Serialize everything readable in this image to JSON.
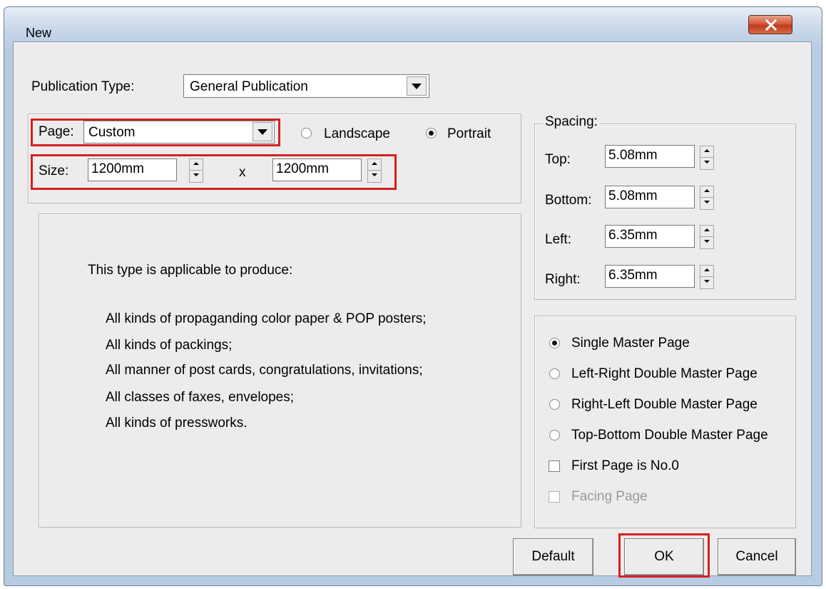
{
  "window": {
    "title": "New"
  },
  "publication": {
    "label": "Publication Type:",
    "value": "General Publication"
  },
  "page": {
    "label": "Page:",
    "value": "Custom"
  },
  "orientation": {
    "landscape_label": "Landscape",
    "portrait_label": "Portrait",
    "selected": "Portrait"
  },
  "size": {
    "label": "Size:",
    "width": "1200mm",
    "separator": "x",
    "height": "1200mm"
  },
  "description": {
    "heading": "This type is applicable to produce:",
    "lines": [
      "All kinds of propaganding color paper & POP posters;",
      "All kinds of packings;",
      "All manner of post cards, congratulations, invitations;",
      "All classes of faxes, envelopes;",
      "All kinds of pressworks."
    ]
  },
  "spacing": {
    "title": "Spacing:",
    "top_label": "Top:",
    "top_value": "5.08mm",
    "bottom_label": "Bottom:",
    "bottom_value": "5.08mm",
    "left_label": "Left:",
    "left_value": "6.35mm",
    "right_label": "Right:",
    "right_value": "6.35mm"
  },
  "master": {
    "single": "Single Master Page",
    "left_right": "Left-Right Double Master Page",
    "right_left": "Right-Left Double Master Page",
    "top_bottom": "Top-Bottom Double Master Page",
    "selected": "Single Master Page"
  },
  "options": {
    "first_page": "First Page is No.0",
    "facing": "Facing Page"
  },
  "buttons": {
    "default": "Default",
    "ok": "OK",
    "cancel": "Cancel"
  },
  "colors": {
    "highlight": "#d62020",
    "close_button": "#c8472a"
  }
}
